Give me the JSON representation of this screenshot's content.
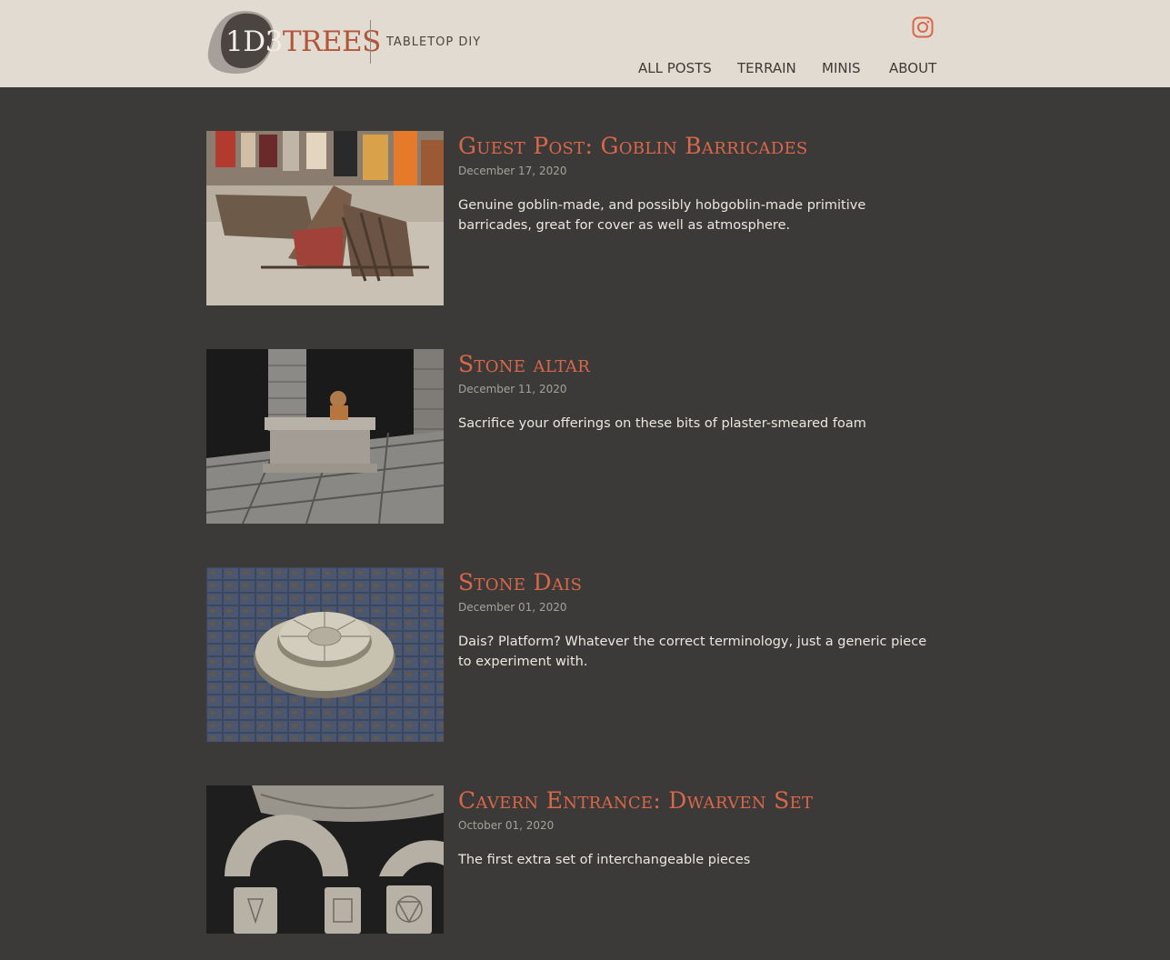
{
  "site": {
    "logo_part1": "1D3",
    "logo_part2": "TREES",
    "tagline": "TABLETOP DIY"
  },
  "nav": {
    "items": [
      {
        "label": "ALL POSTS"
      },
      {
        "label": "TERRAIN"
      },
      {
        "label": "MINIS"
      },
      {
        "label": "ABOUT"
      }
    ]
  },
  "social": {
    "icon": "instagram-icon"
  },
  "colors": {
    "header_bg": "#e2dbd2",
    "page_bg": "#3c3a38",
    "accent": "#d9674a",
    "logo_accent": "#b0563a"
  },
  "posts": [
    {
      "title": "Guest Post: Goblin Barricades",
      "date": "December 17, 2020",
      "excerpt": "Genuine goblin-made, and possibly hobgoblin-made primitive barricades, great for cover as well as atmosphere."
    },
    {
      "title": "Stone altar",
      "date": "December 11, 2020",
      "excerpt": "Sacrifice your offerings on these bits of plaster-smeared foam"
    },
    {
      "title": "Stone Dais",
      "date": "December 01, 2020",
      "excerpt": "Dais? Platform? Whatever the correct terminology, just a generic piece to experiment with."
    },
    {
      "title": "Cavern Entrance: Dwarven Set",
      "date": "October 01, 2020",
      "excerpt": "The first extra set of interchangeable pieces"
    }
  ]
}
